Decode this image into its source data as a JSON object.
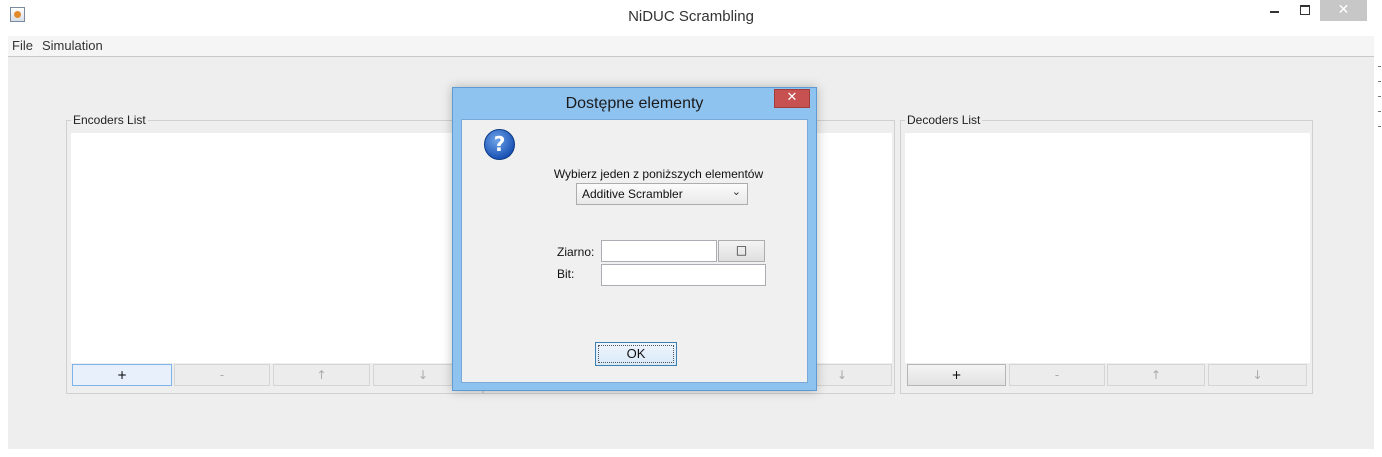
{
  "window": {
    "title": "NiDUC Scrambling",
    "close_glyph": "✕"
  },
  "menu": {
    "file": "File",
    "simulation": "Simulation"
  },
  "encoders": {
    "title": "Encoders List",
    "buttons": {
      "add": "+",
      "remove": "-",
      "up": "↑",
      "down": "↓"
    }
  },
  "decoders": {
    "title": "Decoders List",
    "buttons": {
      "add": "+",
      "remove": "-",
      "up": "↑",
      "down": "↓"
    }
  },
  "middle": {
    "buttons": {
      "down": "↓"
    }
  },
  "dialog": {
    "title": "Dostępne elementy",
    "close_glyph": "✕",
    "icon": "question-icon",
    "prompt": "Wybierz jeden z poniższych elementów",
    "combo_value": "Additive Scrambler",
    "combo_arrow": "⌄",
    "ziarno_label": "Ziarno:",
    "ziarno_value": "",
    "ziarno_button_glyph": "□",
    "bit_label": "Bit:",
    "bit_value": "",
    "ok_label": "OK"
  },
  "colors": {
    "dialog_frame": "#8ec2ef",
    "close_red": "#c75050",
    "focus_blue": "#7eb4ea"
  }
}
